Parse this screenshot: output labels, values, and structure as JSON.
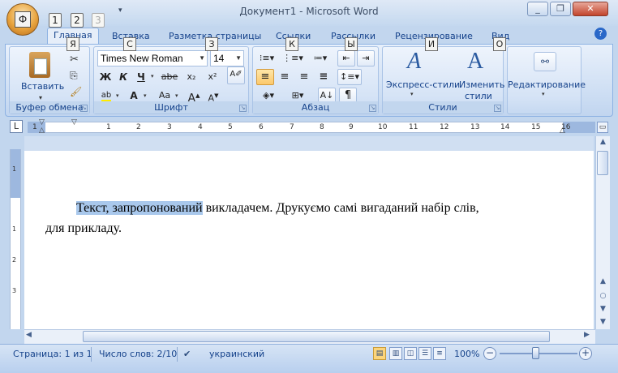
{
  "window": {
    "title": "Документ1 - Microsoft Word",
    "minimize_icon": "minimize-icon",
    "maximize_icon": "restore-icon",
    "close_icon": "close-icon"
  },
  "office_button": {
    "keytip": "Ф"
  },
  "qat": {
    "keytips": [
      "1",
      "2",
      "3"
    ]
  },
  "tabs": [
    {
      "label": "Главная",
      "keytip": "Я",
      "active": true
    },
    {
      "label": "Вставка",
      "keytip": "С"
    },
    {
      "label": "Разметка страницы",
      "keytip": "З"
    },
    {
      "label": "Ссылки",
      "keytip": "К"
    },
    {
      "label": "Рассылки",
      "keytip": "Ы"
    },
    {
      "label": "Рецензирование",
      "keytip": "И"
    },
    {
      "label": "Вид",
      "keytip": "О"
    }
  ],
  "ribbon": {
    "clipboard": {
      "label": "Буфер обмена",
      "paste_label": "Вставить"
    },
    "font": {
      "label": "Шрифт",
      "font_name": "Times New Roman",
      "font_size": "14",
      "bold": "Ж",
      "italic": "К",
      "underline": "Ч",
      "strike": "abe",
      "subscript": "x₂",
      "superscript": "x²",
      "change_case": "Aa",
      "grow": "A",
      "shrink": "A"
    },
    "paragraph": {
      "label": "Абзац"
    },
    "styles": {
      "label": "Стили",
      "quick_styles": "Экспресс-стили",
      "change_styles_1": "Изменить",
      "change_styles_2": "стили"
    },
    "editing": {
      "label": "Редактирование"
    }
  },
  "ruler": {
    "numbers": [
      "1",
      "1",
      "2",
      "3",
      "4",
      "5",
      "6",
      "7",
      "8",
      "9",
      "10",
      "11",
      "12",
      "13",
      "14",
      "15",
      "16"
    ],
    "vnumbers": [
      "1",
      "1",
      "2",
      "3"
    ]
  },
  "document": {
    "highlighted": "Текст, запропонований",
    "rest_line1": " викладачем. Друкуємо самі вигаданий набір слів,",
    "line2": "для прикладу."
  },
  "status": {
    "page": "Страница: 1 из 1",
    "words": "Число слов: 2/10",
    "language": "украинский",
    "zoom": "100%"
  },
  "colors": {
    "accent": "#15428b",
    "ribbon": "#c2d6ee",
    "highlight": "#a9c8ec"
  }
}
